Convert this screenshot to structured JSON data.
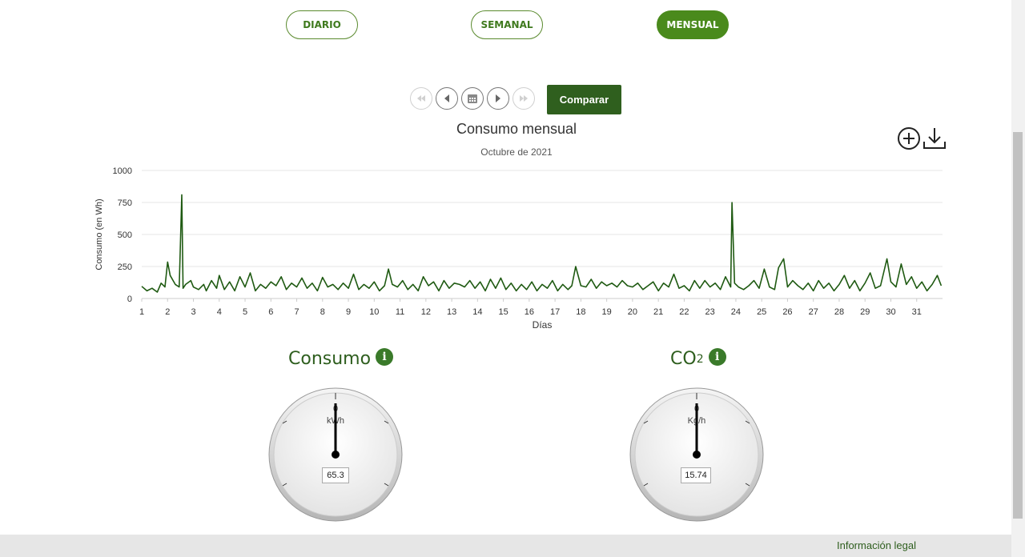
{
  "tabs": [
    {
      "label": "DIARIO",
      "active": false
    },
    {
      "label": "SEMANAL",
      "active": false
    },
    {
      "label": "MENSUAL",
      "active": true
    }
  ],
  "navigation": {
    "compare_label": "Comparar",
    "buttons": [
      "first-icon",
      "previous-icon",
      "calendar-icon",
      "next-icon",
      "last-icon"
    ]
  },
  "chart_tools": [
    "zoom-in-icon",
    "download-icon"
  ],
  "chart_data": {
    "type": "line",
    "title": "Consumo mensual",
    "subtitle": "Octubre de 2021",
    "xlabel": "Días",
    "ylabel": "Consumo (en Wh)",
    "ylim": [
      0,
      1000
    ],
    "yticks": [
      "0",
      "250",
      "500",
      "750",
      "1000"
    ],
    "xticks": [
      "1",
      "2",
      "3",
      "4",
      "5",
      "6",
      "7",
      "8",
      "9",
      "10",
      "11",
      "12",
      "13",
      "14",
      "15",
      "16",
      "17",
      "18",
      "19",
      "20",
      "21",
      "22",
      "23",
      "24",
      "25",
      "26",
      "27",
      "28",
      "29",
      "30",
      "31"
    ],
    "grid": true,
    "color": "#1f5a12",
    "series": [
      {
        "x": [
          1,
          1.2,
          1.4,
          1.6,
          1.75,
          1.9,
          2.0,
          2.1,
          2.3,
          2.45,
          2.55,
          2.6,
          2.7,
          2.9,
          3.0,
          3.2,
          3.4,
          3.5,
          3.7,
          3.9,
          4.0,
          4.2,
          4.4,
          4.6,
          4.8,
          5.0,
          5.2,
          5.4,
          5.6,
          5.8,
          6.0,
          6.2,
          6.4,
          6.6,
          6.8,
          7.0,
          7.2,
          7.4,
          7.6,
          7.8,
          8.0,
          8.2,
          8.4,
          8.6,
          8.8,
          9.0,
          9.2,
          9.4,
          9.6,
          9.8,
          10.0,
          10.2,
          10.4,
          10.55,
          10.7,
          10.9,
          11.1,
          11.3,
          11.5,
          11.7,
          11.9,
          12.1,
          12.3,
          12.5,
          12.7,
          12.9,
          13.1,
          13.3,
          13.5,
          13.7,
          13.9,
          14.1,
          14.3,
          14.5,
          14.7,
          14.9,
          15.1,
          15.3,
          15.5,
          15.7,
          15.9,
          16.1,
          16.3,
          16.5,
          16.7,
          16.9,
          17.1,
          17.3,
          17.5,
          17.65,
          17.8,
          18.0,
          18.2,
          18.4,
          18.6,
          18.8,
          19.0,
          19.2,
          19.4,
          19.6,
          19.8,
          20.0,
          20.2,
          20.4,
          20.6,
          20.8,
          21.0,
          21.2,
          21.4,
          21.6,
          21.8,
          22.0,
          22.2,
          22.4,
          22.6,
          22.8,
          23.0,
          23.2,
          23.4,
          23.6,
          23.8,
          23.85,
          23.95,
          24.1,
          24.3,
          24.5,
          24.7,
          24.9,
          25.1,
          25.3,
          25.5,
          25.65,
          25.85,
          26.0,
          26.2,
          26.4,
          26.6,
          26.8,
          27.0,
          27.2,
          27.4,
          27.6,
          27.8,
          28.0,
          28.2,
          28.4,
          28.6,
          28.8,
          29.0,
          29.2,
          29.4,
          29.6,
          29.85,
          30.0,
          30.2,
          30.4,
          30.6,
          30.8,
          31.0,
          31.2,
          31.4,
          31.6,
          31.8,
          31.95
        ],
        "y": [
          95,
          60,
          80,
          50,
          120,
          90,
          285,
          180,
          110,
          90,
          810,
          80,
          110,
          140,
          90,
          70,
          110,
          60,
          140,
          80,
          180,
          70,
          130,
          60,
          170,
          90,
          200,
          60,
          110,
          80,
          130,
          100,
          170,
          70,
          120,
          90,
          160,
          80,
          120,
          60,
          165,
          90,
          110,
          70,
          120,
          80,
          190,
          70,
          110,
          80,
          130,
          60,
          100,
          230,
          110,
          90,
          140,
          70,
          110,
          60,
          170,
          100,
          130,
          60,
          140,
          80,
          120,
          110,
          90,
          140,
          80,
          130,
          60,
          150,
          80,
          160,
          70,
          120,
          60,
          110,
          70,
          130,
          60,
          110,
          80,
          140,
          60,
          110,
          70,
          100,
          250,
          100,
          90,
          150,
          80,
          130,
          100,
          120,
          90,
          140,
          100,
          90,
          120,
          70,
          100,
          130,
          60,
          120,
          90,
          190,
          80,
          100,
          60,
          140,
          80,
          140,
          90,
          120,
          70,
          170,
          90,
          750,
          120,
          90,
          70,
          100,
          140,
          80,
          230,
          90,
          70,
          240,
          310,
          90,
          140,
          100,
          70,
          120,
          60,
          140,
          80,
          120,
          60,
          110,
          180,
          80,
          140,
          60,
          120,
          200,
          80,
          100,
          310,
          130,
          90,
          270,
          110,
          170,
          80,
          130,
          60,
          110,
          180,
          100
        ]
      }
    ]
  },
  "gauges": [
    {
      "title": "Consumo",
      "title_sub": "",
      "value": "65.3",
      "unit": "kWh",
      "zero": "0"
    },
    {
      "title": "CO",
      "title_sub": "2",
      "value": "15.74",
      "unit": "Kg/h",
      "zero": "0"
    }
  ],
  "info_icon_glyph": "i",
  "footer": {
    "legal": "Información legal"
  }
}
